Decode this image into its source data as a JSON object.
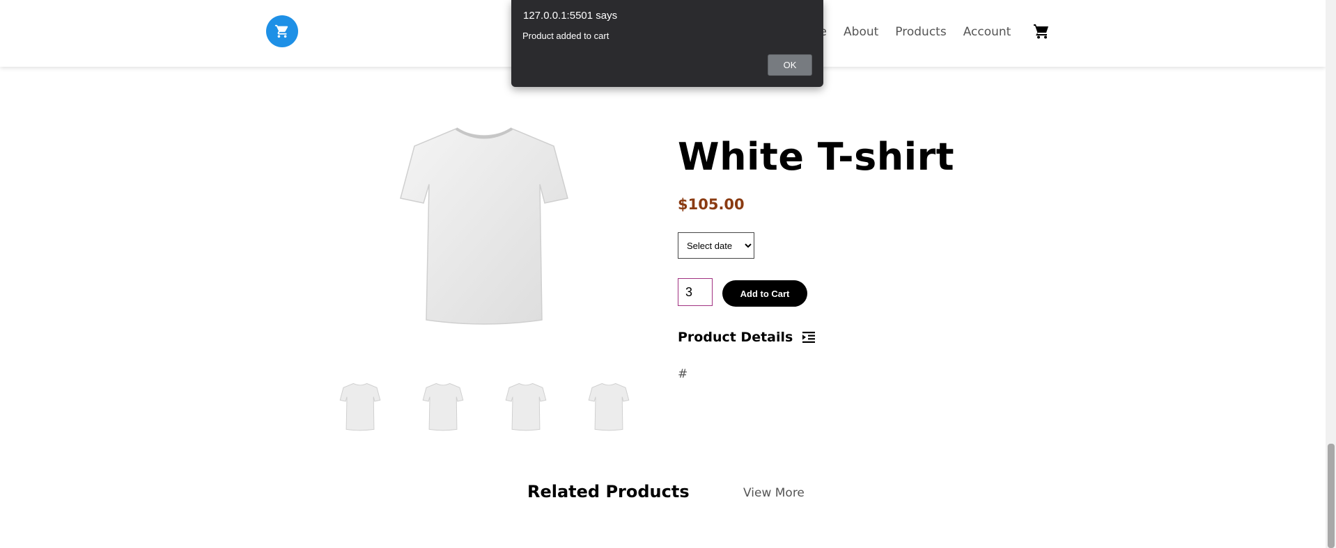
{
  "header": {
    "nav": [
      "me",
      "About",
      "Products",
      "Account"
    ]
  },
  "product": {
    "title": "White T-shirt",
    "price": "$105.00",
    "select_option": "Select date",
    "quantity": "3",
    "add_button": "Add to Cart",
    "details_heading": "Product Details",
    "details_text": "#"
  },
  "related": {
    "heading": "Related Products",
    "view_more": "View More"
  },
  "dialog": {
    "origin": "127.0.0.1:5501 says",
    "message": "Product added to cart",
    "ok": "OK"
  },
  "colors": {
    "logo": "#1e90e6",
    "price": "#8a3b12",
    "dialog_bg": "#2b2b2e"
  }
}
